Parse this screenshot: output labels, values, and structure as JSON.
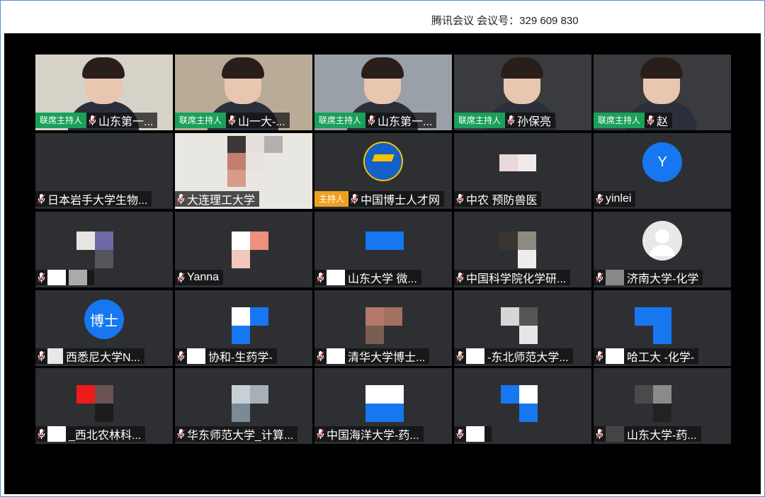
{
  "window": {
    "title": "腾讯会议 会议号：329 609 830"
  },
  "roles": {
    "cohost": "联席主持人",
    "host": "主持人"
  },
  "participants": [
    {
      "name": "山东第一...",
      "role": "cohost",
      "kind": "photo",
      "bg": "#d6d2c8"
    },
    {
      "name": "山一大-...",
      "role": "cohost",
      "kind": "photo",
      "bg": "#b9ab96"
    },
    {
      "name": "山东第一...",
      "role": "cohost",
      "kind": "photo",
      "bg": "#9aa0a8"
    },
    {
      "name": "孙保亮",
      "role": "cohost",
      "kind": "photo",
      "bg": "#3a3b3f"
    },
    {
      "name": "赵",
      "role": "cohost",
      "kind": "photo",
      "bg": "#3a3b3f"
    },
    {
      "name": "日本岩手大学生物...",
      "role": "",
      "kind": "none",
      "bg": "#2e2f33"
    },
    {
      "name": "大连理工大学",
      "role": "",
      "kind": "mosaic",
      "bg": "#e9e7e2"
    },
    {
      "name": "中国博士人才网",
      "role": "host",
      "kind": "logo",
      "bg": "#2e2f33"
    },
    {
      "name": "中农 预防兽医",
      "role": "",
      "kind": "mosaic",
      "bg": "#2e2f33"
    },
    {
      "name": "yinlei",
      "role": "",
      "kind": "avatar",
      "avatar_text": "Y",
      "bg": "#2e2f33"
    },
    {
      "name": "",
      "role": "",
      "kind": "mosaic",
      "bg": "#2e2f33"
    },
    {
      "name": "Yanna",
      "role": "",
      "kind": "mosaic",
      "bg": "#2e2f33"
    },
    {
      "name": "山东大学 微...",
      "role": "",
      "kind": "mosaic",
      "bg": "#2e2f33"
    },
    {
      "name": "中国科学院化学研...",
      "role": "",
      "kind": "mosaic",
      "bg": "#2e2f33"
    },
    {
      "name": "济南大学-化学",
      "role": "",
      "kind": "avatar-default",
      "bg": "#2e2f33"
    },
    {
      "name": "西悉尼大学N...",
      "role": "",
      "kind": "avatar",
      "avatar_text": "博士",
      "bg": "#2e2f33"
    },
    {
      "name": "协和-生药学-",
      "role": "",
      "kind": "mosaic",
      "bg": "#2e2f33"
    },
    {
      "name": "清华大学博士...",
      "role": "",
      "kind": "mosaic",
      "bg": "#2e2f33"
    },
    {
      "name": "-东北师范大学...",
      "role": "",
      "kind": "mosaic",
      "bg": "#2e2f33"
    },
    {
      "name": "哈工大 -化学-",
      "role": "",
      "kind": "mosaic",
      "bg": "#2e2f33"
    },
    {
      "name": "_西北农林科...",
      "role": "",
      "kind": "mosaic",
      "bg": "#2e2f33"
    },
    {
      "name": "华东师范大学_计算...",
      "role": "",
      "kind": "mosaic",
      "bg": "#2e2f33"
    },
    {
      "name": "中国海洋大学-药...",
      "role": "",
      "kind": "mosaic",
      "bg": "#2e2f33"
    },
    {
      "name": "",
      "role": "",
      "kind": "mosaic",
      "bg": "#2e2f33"
    },
    {
      "name": "山东大学-药...",
      "role": "",
      "kind": "mosaic",
      "bg": "#2e2f33"
    }
  ]
}
